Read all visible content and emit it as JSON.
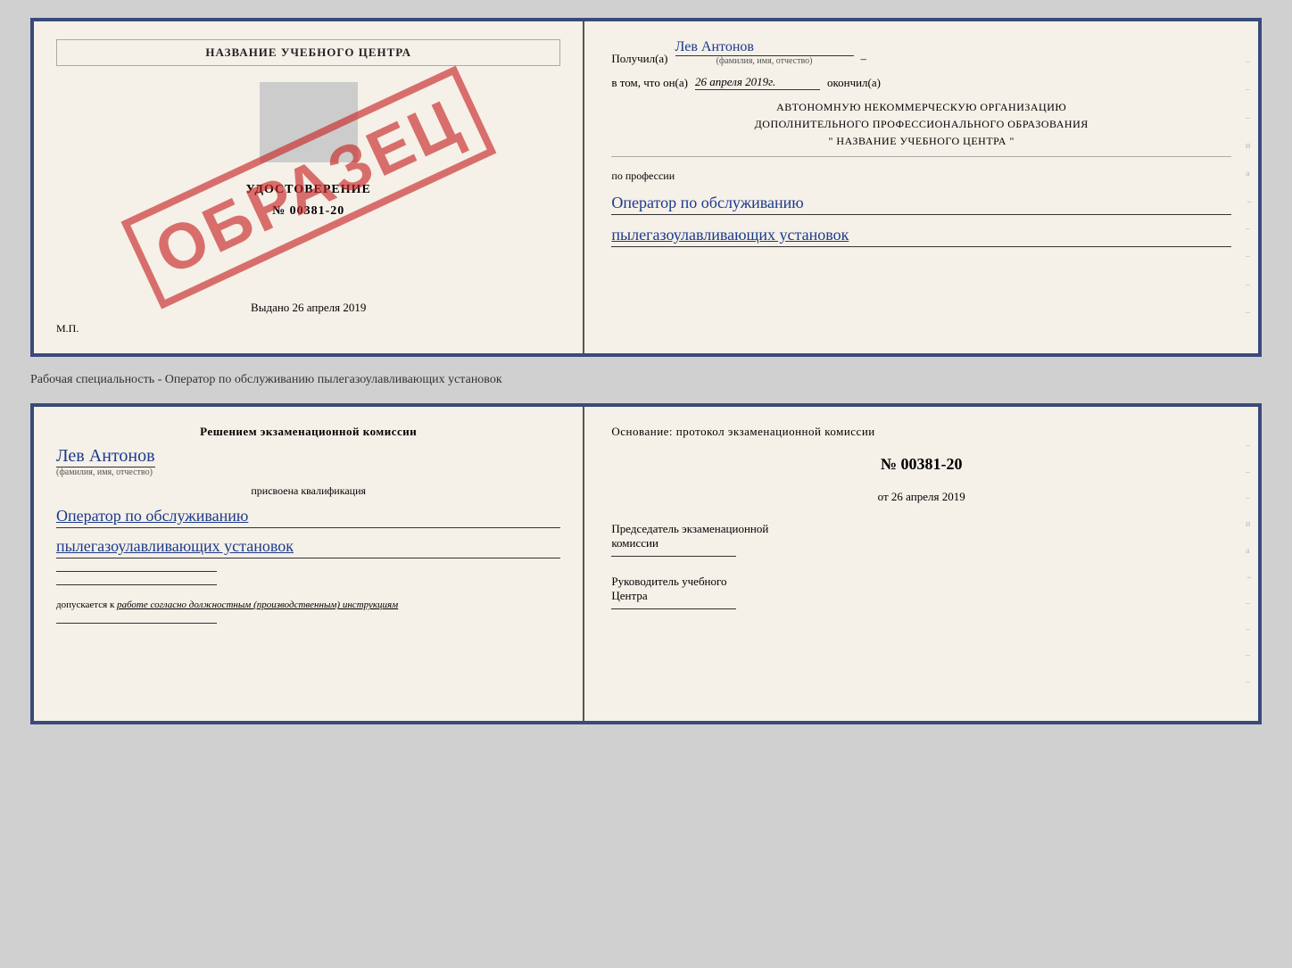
{
  "page": {
    "background": "#d0d0d0"
  },
  "top_cert": {
    "left": {
      "school_name": "НАЗВАНИЕ УЧЕБНОГО ЦЕНТРА",
      "stamp": "ОБРАЗЕЦ",
      "udostoverenie": "УДОСТОВЕРЕНИЕ",
      "number": "№ 00381-20",
      "vydano_label": "Выдано",
      "vydano_date": "26 апреля 2019",
      "mp_label": "М.П."
    },
    "right": {
      "poluchil_label": "Получил(а)",
      "recipient_name": "Лев Антонов",
      "fio_hint": "(фамилия, имя, отчество)",
      "dash": "–",
      "v_tom_label": "в том, что он(а)",
      "date_value": "26 апреля 2019г.",
      "okonchil_label": "окончил(а)",
      "org_line1": "АВТОНОМНУЮ НЕКОММЕРЧЕСКУЮ ОРГАНИЗАЦИЮ",
      "org_line2": "ДОПОЛНИТЕЛЬНОГО ПРОФЕССИОНАЛЬНОГО ОБРАЗОВАНИЯ",
      "org_line3": "\"   НАЗВАНИЕ УЧЕБНОГО ЦЕНТРА   \"",
      "po_professii": "по профессии",
      "profession1": "Оператор по обслуживанию",
      "profession2": "пылегазоулавливающих установок"
    }
  },
  "between_label": "Рабочая специальность - Оператор по обслуживанию пылегазоулавливающих установок",
  "bottom_cert": {
    "left": {
      "resheniyem_label": "Решением экзаменационной комиссии",
      "name_script": "Лев Антонов",
      "fio_hint": "(фамилия, имя, отчество)",
      "prisvoyena_label": "присвоена квалификация",
      "kvali1": "Оператор по обслуживанию",
      "kvali2": "пылегазоулавливающих установок",
      "dopuskaetsya": "допускается к",
      "dopusk_italic": "работе согласно должностным (производственным) инструкциям"
    },
    "right": {
      "osnovanie_label": "Основание: протокол экзаменационной комиссии",
      "number_label": "№ 00381-20",
      "ot_label": "от",
      "ot_date": "26 апреля 2019",
      "predsedatel_line1": "Председатель экзаменационной",
      "predsedatel_line2": "комиссии",
      "rukovoditel_line1": "Руководитель учебного",
      "rukovoditel_line2": "Центра"
    }
  }
}
